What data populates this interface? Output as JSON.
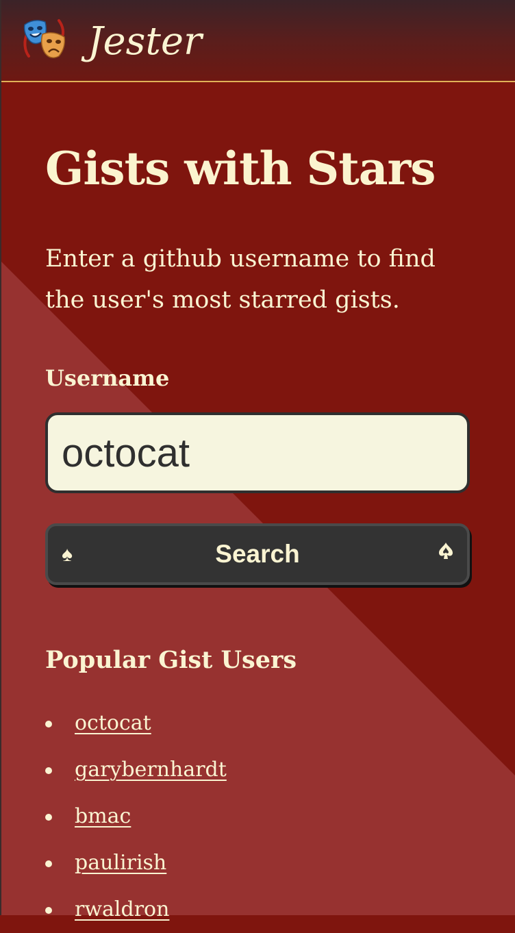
{
  "header": {
    "brand": "Jester",
    "logo_icon": "theater-masks-icon"
  },
  "main": {
    "title": "Gists with Stars",
    "intro": "Enter a github username to find the user's most starred gists.",
    "form": {
      "username_label": "Username",
      "username_value": "octocat",
      "search_label": "Search",
      "left_glyph": "♠",
      "right_glyph": "♠"
    },
    "popular": {
      "heading": "Popular Gist Users",
      "users": [
        "octocat",
        "garybernhardt",
        "bmac",
        "paulirish",
        "rwaldron"
      ]
    }
  },
  "colors": {
    "background": "#7f150e",
    "diagonal_band": "#973230",
    "header": "#3b2328",
    "header_border": "#e2b258",
    "text": "#faf4d2",
    "input_bg": "#f6f5df",
    "button_bg": "#333333"
  }
}
